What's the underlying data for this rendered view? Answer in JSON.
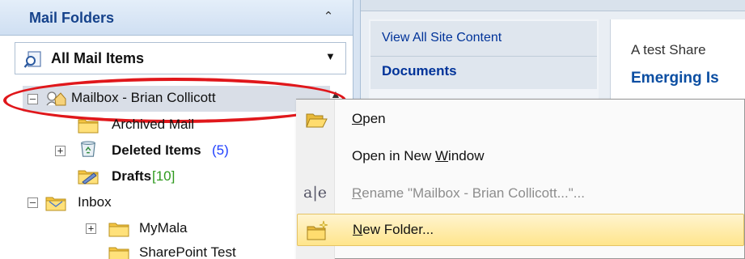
{
  "mail_pane": {
    "header_title": "Mail Folders",
    "all_mail_label": "All Mail Items",
    "tree": {
      "mailbox": {
        "label": "Mailbox - Brian Collicott"
      },
      "archived": {
        "label": "Archived Mail"
      },
      "deleted": {
        "label": "Deleted Items",
        "count": "(5)"
      },
      "drafts": {
        "label": "Drafts",
        "count": "[10]"
      },
      "inbox": {
        "label": "Inbox"
      },
      "mymala": {
        "label": "MyMala"
      },
      "sharepoint_test": {
        "label": "SharePoint Test"
      }
    }
  },
  "sharepoint": {
    "quick_launch": [
      "View All Site Content",
      "Documents"
    ],
    "description": "A test Share",
    "heading": "Emerging Is"
  },
  "context_menu": {
    "items": [
      {
        "label_prefix": "",
        "label_accel": "O",
        "label_rest": "pen",
        "icon": "open-folder-icon",
        "enabled": true
      },
      {
        "label_prefix": "Open in New ",
        "label_accel": "W",
        "label_rest": "indow",
        "icon": "",
        "enabled": true
      },
      {
        "label_prefix": "",
        "label_accel": "R",
        "label_rest": "ename \"Mailbox - Brian Collicott...\"...",
        "icon": "rename-icon",
        "enabled": false
      },
      {
        "label_prefix": "",
        "label_accel": "N",
        "label_rest": "ew Folder...",
        "icon": "new-folder-icon",
        "enabled": true,
        "highlighted": true
      }
    ]
  },
  "colors": {
    "header_text": "#15428b",
    "highlight_ellipse": "#e0171b",
    "deleted_count": "#1f3fff",
    "drafts_count": "#2f9a1e",
    "menu_highlight": "#ffe58c"
  }
}
